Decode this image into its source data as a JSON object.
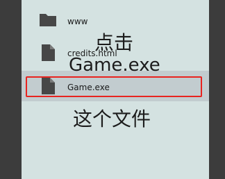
{
  "file_list": {
    "items": [
      {
        "label": "www",
        "icon": "folder-icon"
      },
      {
        "label": "credits.html",
        "icon": "file-icon"
      },
      {
        "label": "Game.exe",
        "icon": "file-icon",
        "selected": true
      }
    ]
  },
  "annotation": {
    "line1": "点击",
    "line2": "Game.exe",
    "line3": "这个文件",
    "highlight_color": "#e8231f"
  },
  "colors": {
    "panel_background": "#d4e2e1",
    "selected_row": "#c2cccf",
    "side_edges": "#3c3c3c"
  }
}
